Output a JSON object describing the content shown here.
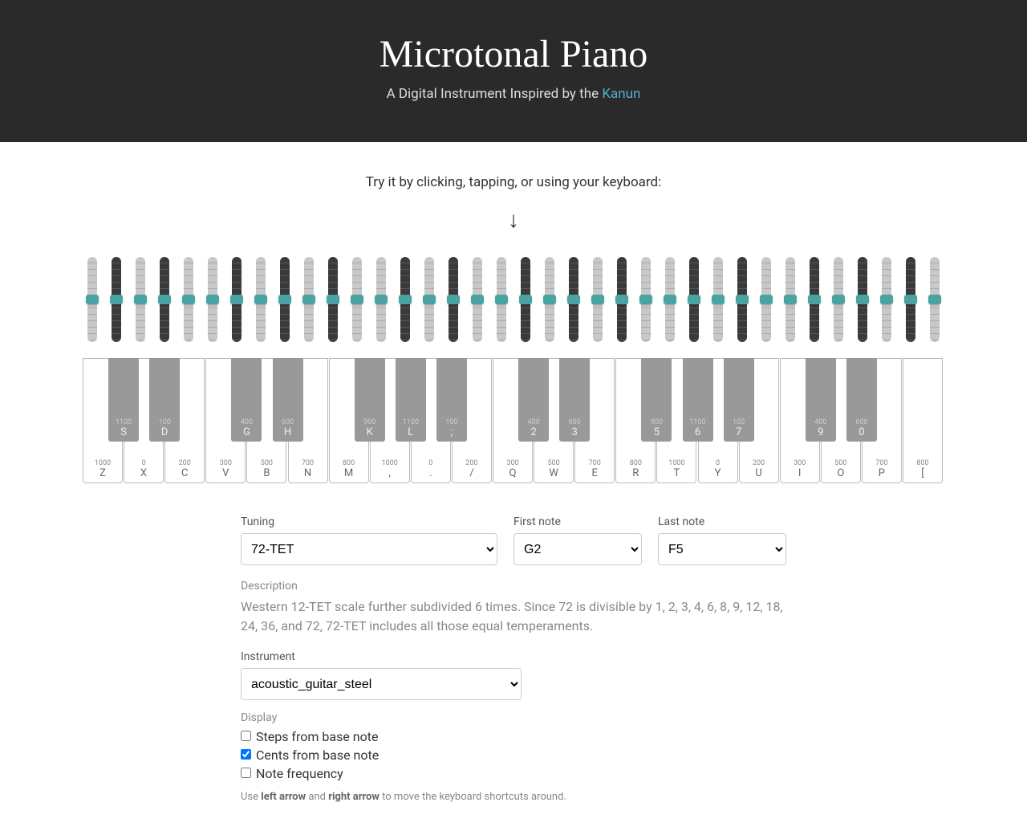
{
  "header": {
    "title": "Microtonal Piano",
    "subtitle_prefix": "A Digital Instrument Inspired by the ",
    "link_text": "Kanun"
  },
  "try": {
    "text": "Try it by clicking, tapping, or using your keyboard:"
  },
  "sliders": [
    "light",
    "dark",
    "light",
    "dark",
    "light",
    "light",
    "dark",
    "light",
    "dark",
    "light",
    "dark",
    "light",
    "light",
    "dark",
    "light",
    "dark",
    "light",
    "light",
    "dark",
    "light",
    "dark",
    "light",
    "dark",
    "light",
    "light",
    "dark",
    "light",
    "dark",
    "light",
    "light",
    "dark",
    "light",
    "dark",
    "light",
    "dark",
    "light"
  ],
  "white_keys": [
    {
      "cents": "1000",
      "letter": "Z"
    },
    {
      "cents": "0",
      "letter": "X"
    },
    {
      "cents": "200",
      "letter": "C"
    },
    {
      "cents": "300",
      "letter": "V"
    },
    {
      "cents": "500",
      "letter": "B"
    },
    {
      "cents": "700",
      "letter": "N"
    },
    {
      "cents": "800",
      "letter": "M"
    },
    {
      "cents": "1000",
      "letter": ","
    },
    {
      "cents": "0",
      "letter": "."
    },
    {
      "cents": "200",
      "letter": "/"
    },
    {
      "cents": "300",
      "letter": "Q"
    },
    {
      "cents": "500",
      "letter": "W"
    },
    {
      "cents": "700",
      "letter": "E"
    },
    {
      "cents": "800",
      "letter": "R"
    },
    {
      "cents": "1000",
      "letter": "T"
    },
    {
      "cents": "0",
      "letter": "Y"
    },
    {
      "cents": "200",
      "letter": "U"
    },
    {
      "cents": "300",
      "letter": "I"
    },
    {
      "cents": "500",
      "letter": "O"
    },
    {
      "cents": "700",
      "letter": "P"
    },
    {
      "cents": "800",
      "letter": "["
    }
  ],
  "black_keys": [
    {
      "cents": "1100",
      "letter": "S",
      "after": 0
    },
    {
      "cents": "100",
      "letter": "D",
      "after": 1
    },
    {
      "cents": "400",
      "letter": "G",
      "after": 3
    },
    {
      "cents": "600",
      "letter": "H",
      "after": 4
    },
    {
      "cents": "900",
      "letter": "K",
      "after": 6
    },
    {
      "cents": "1100",
      "letter": "L",
      "after": 7
    },
    {
      "cents": "100",
      "letter": ";",
      "after": 8
    },
    {
      "cents": "400",
      "letter": "2",
      "after": 10
    },
    {
      "cents": "600",
      "letter": "3",
      "after": 11
    },
    {
      "cents": "900",
      "letter": "5",
      "after": 13
    },
    {
      "cents": "1100",
      "letter": "6",
      "after": 14
    },
    {
      "cents": "100",
      "letter": "7",
      "after": 15
    },
    {
      "cents": "400",
      "letter": "9",
      "after": 17
    },
    {
      "cents": "600",
      "letter": "0",
      "after": 18
    }
  ],
  "controls": {
    "tuning_label": "Tuning",
    "tuning_value": "72-TET",
    "first_note_label": "First note",
    "first_note_value": "G2",
    "last_note_label": "Last note",
    "last_note_value": "F5",
    "desc_label": "Description",
    "desc_text": "Western 12-TET scale further subdivided 6 times. Since 72 is divisible by 1, 2, 3, 4, 6, 8, 9, 12, 18, 24, 36, and 72, 72-TET includes all those equal temperaments.",
    "instrument_label": "Instrument",
    "instrument_value": "acoustic_guitar_steel",
    "display_label": "Display",
    "check_steps": "Steps from base note",
    "check_cents": "Cents from base note",
    "check_freq": "Note frequency",
    "hint_prefix": "Use ",
    "hint_left": "left arrow",
    "hint_and": " and ",
    "hint_right": "right arrow",
    "hint_suffix": " to move the keyboard shortcuts around."
  }
}
